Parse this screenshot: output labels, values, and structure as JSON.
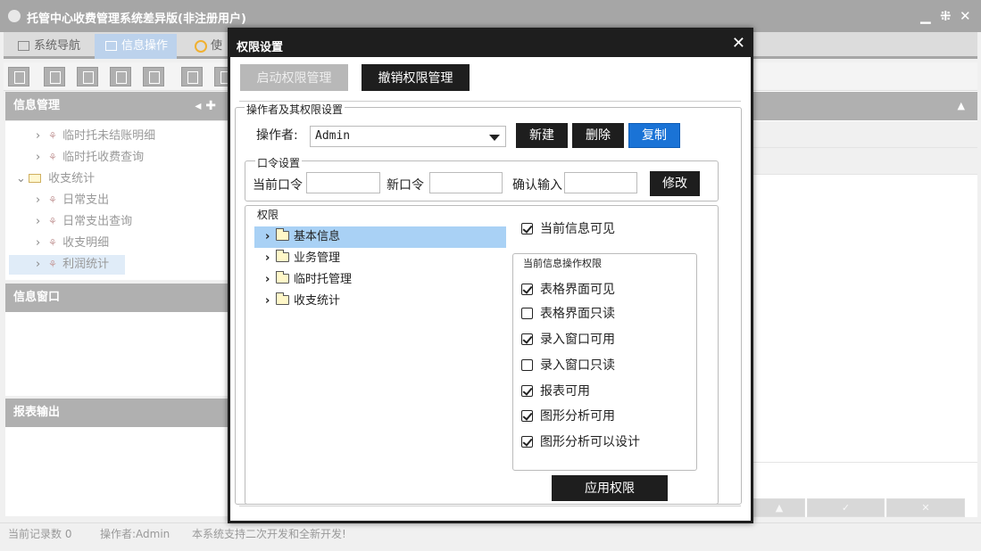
{
  "app": {
    "title": "托管中心收费管理系统差异版(非注册用户)",
    "controls": {
      "minimize": "▁",
      "restore": "⁜",
      "close": "✕"
    }
  },
  "tabs": [
    {
      "label": "系统导航"
    },
    {
      "label": "信息操作"
    },
    {
      "label": "使"
    }
  ],
  "sidebar": {
    "info_mgmt_header": "信息管理",
    "info_mgmt_tools": "◂ ✚",
    "tree": [
      {
        "label": "临时托未结账明细",
        "kind": "leaf"
      },
      {
        "label": "临时托收费查询",
        "kind": "leaf"
      },
      {
        "label": "收支统计",
        "kind": "folder"
      },
      {
        "label": "日常支出",
        "kind": "leaf"
      },
      {
        "label": "日常支出查询",
        "kind": "leaf"
      },
      {
        "label": "收支明细",
        "kind": "leaf"
      },
      {
        "label": "利润统计",
        "kind": "leaf"
      }
    ],
    "info_window_header": "信息窗口",
    "report_output_header": "报表输出"
  },
  "statusbar": {
    "record_count": "当前记录数 0",
    "operator": "操作者:Admin",
    "slogan": "本系统支持二次开发和全新开发!"
  },
  "modal": {
    "title": "权限设置",
    "close_glyph": "✕",
    "enable_button": "启动权限管理",
    "revoke_button": "撤销权限管理",
    "operator_section": {
      "legend": "操作者及其权限设置",
      "operator_label": "操作者:",
      "operator_value": "Admin",
      "new_button": "新建",
      "delete_button": "删除",
      "copy_button": "复制"
    },
    "password_section": {
      "legend": "口令设置",
      "current_label": "当前口令",
      "new_label": "新口令",
      "confirm_label": "确认输入",
      "current_value": "",
      "new_value": "",
      "confirm_value": "",
      "modify_button": "修改"
    },
    "permissions_section": {
      "legend": "权限",
      "tree": [
        {
          "label": "基本信息",
          "selected": true
        },
        {
          "label": "业务管理",
          "selected": false
        },
        {
          "label": "临时托管理",
          "selected": false
        },
        {
          "label": "收支统计",
          "selected": false
        }
      ],
      "current_visible": {
        "label": "当前信息可见",
        "checked": true
      },
      "ops_legend": "当前信息操作权限",
      "ops": [
        {
          "label": "表格界面可见",
          "checked": true
        },
        {
          "label": "表格界面只读",
          "checked": false
        },
        {
          "label": "录入窗口可用",
          "checked": true
        },
        {
          "label": "录入窗口只读",
          "checked": false
        },
        {
          "label": "报表可用",
          "checked": true
        },
        {
          "label": "图形分析可用",
          "checked": true
        },
        {
          "label": "图形分析可以设计",
          "checked": true
        }
      ],
      "apply_button": "应用权限"
    }
  }
}
